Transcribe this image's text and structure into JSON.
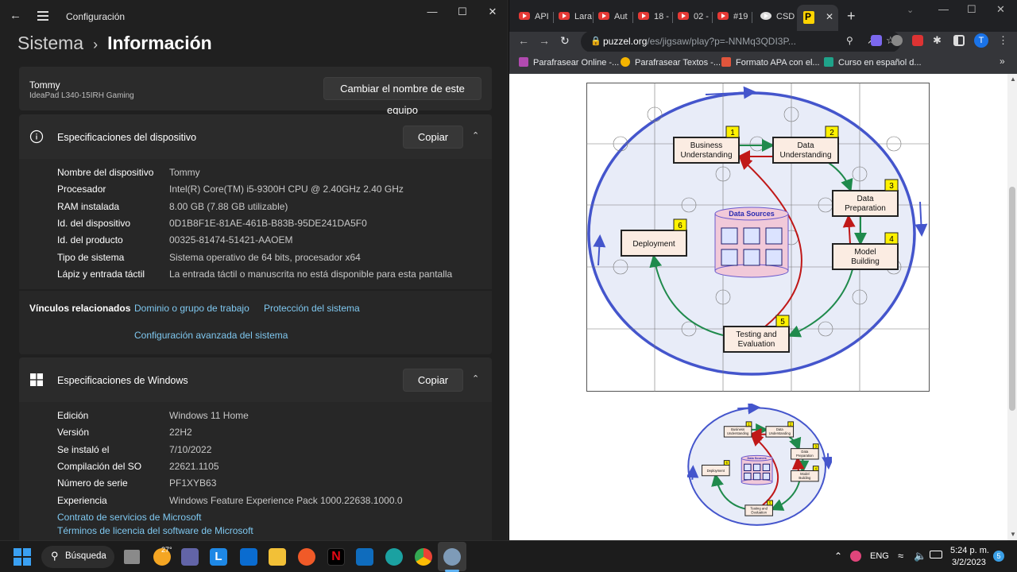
{
  "settings": {
    "window_title": "Configuración",
    "breadcrumb": {
      "parent": "Sistema",
      "current": "Información"
    },
    "device": {
      "name": "Tommy",
      "model": "IdeaPad L340-15IRH Gaming",
      "rename_button": "Cambiar el nombre de este equipo"
    },
    "device_specs": {
      "title": "Especificaciones del dispositivo",
      "copy_button": "Copiar",
      "rows": [
        {
          "label": "Nombre del dispositivo",
          "value": "Tommy"
        },
        {
          "label": "Procesador",
          "value": "Intel(R) Core(TM) i5-9300H CPU @ 2.40GHz   2.40 GHz"
        },
        {
          "label": "RAM instalada",
          "value": "8.00 GB (7.88 GB utilizable)"
        },
        {
          "label": "Id. del dispositivo",
          "value": "0D1B8F1E-81AE-461B-B83B-95DE241DA5F0"
        },
        {
          "label": "Id. del producto",
          "value": "00325-81474-51421-AAOEM"
        },
        {
          "label": "Tipo de sistema",
          "value": "Sistema operativo de 64 bits, procesador x64"
        },
        {
          "label": "Lápiz y entrada táctil",
          "value": "La entrada táctil o manuscrita no está disponible para esta pantalla"
        }
      ]
    },
    "related_links": {
      "label": "Vínculos relacionados",
      "links": [
        "Dominio o grupo de trabajo",
        "Protección del sistema",
        "Configuración avanzada del sistema"
      ]
    },
    "windows_specs": {
      "title": "Especificaciones de Windows",
      "copy_button": "Copiar",
      "rows": [
        {
          "label": "Edición",
          "value": "Windows 11 Home"
        },
        {
          "label": "Versión",
          "value": "22H2"
        },
        {
          "label": "Se instaló el",
          "value": "7/10/2022"
        },
        {
          "label": "Compilación del SO",
          "value": "22621.1105"
        },
        {
          "label": "Número de serie",
          "value": "PF1XYB63"
        },
        {
          "label": "Experiencia",
          "value": "Windows Feature Experience Pack 1000.22638.1000.0"
        }
      ],
      "links": [
        "Contrato de servicios de Microsoft",
        "Términos de licencia del software de Microsoft"
      ]
    }
  },
  "browser": {
    "tabs": [
      "API",
      "Lara",
      "Aut",
      "18 -",
      "02 -",
      "#19",
      "CSD"
    ],
    "active_tab_icon": "puzzel-favicon",
    "url_host": "puzzel.org",
    "url_path": "/es/jigsaw/play?p=-NNMq3QDI3P...",
    "bookmarks": [
      "Parafrasear Online -...",
      "Parafrasear Textos -...",
      "Formato APA con el...",
      "Curso en español d..."
    ],
    "profile_initial": "T"
  },
  "diagram": {
    "nodes": [
      {
        "label": [
          "Business",
          "Understanding"
        ],
        "num": "1"
      },
      {
        "label": [
          "Data",
          "Understanding"
        ],
        "num": "2"
      },
      {
        "label": [
          "Data",
          "Preparation"
        ],
        "num": "3"
      },
      {
        "label": [
          "Model",
          "Building"
        ],
        "num": "4"
      },
      {
        "label": [
          "Testing and",
          "Evaluation"
        ],
        "num": "5"
      },
      {
        "label": [
          "Deployment"
        ],
        "num": "6"
      }
    ],
    "hub": "Data Sources"
  },
  "taskbar": {
    "search": "Búsqueda",
    "weather": "27°",
    "lang": "ENG",
    "time": "5:24 p. m.",
    "date": "3/2/2023",
    "notifications": "5"
  },
  "colors": {
    "accent": "#7fc8f0",
    "settings_bg": "#202020",
    "card_bg": "#2b2b2b",
    "chrome_dark": "#35363a"
  }
}
